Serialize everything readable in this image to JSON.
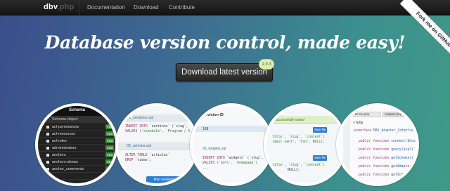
{
  "navbar": {
    "brand": "dbv",
    "brand_suffix": ".php",
    "links": [
      "Documentation",
      "Download",
      "Contribute"
    ]
  },
  "hero": {
    "title": "Database version control, made easy!",
    "download_button": "Download latest version",
    "version_badge": "1.0.3"
  },
  "ribbon": {
    "label": "Fork me on GitHub"
  },
  "screenshots": {
    "schema": {
      "header": "Schema",
      "sub": "Schema object",
      "rows": [
        {
          "name": "acl-permissions",
          "status": "YES"
        },
        {
          "name": "acl-resources",
          "status": "YES"
        },
        {
          "name": "acl-roles",
          "status": "YES"
        },
        {
          "name": "administrators",
          "status": "YES"
        },
        {
          "name": "anchors",
          "status": "YES"
        },
        {
          "name": "anchors-shows",
          "status": "YES"
        },
        {
          "name": "anchor_comments",
          "status": "YES"
        },
        {
          "name": "",
          "status": "YES"
        }
      ]
    },
    "migrations": {
      "file1": "01_sections.sql",
      "file1_line1_kw": "INSERT INTO",
      "file1_line1": " `sections` (`slug`, `",
      "file1_line2_kw": "VALUES",
      "file1_line2": " ('schedule', 'Program / S",
      "file2": "02_articles.sql",
      "file2_line1_kw": "ALTER TABLE",
      "file2_line1": " `articles`",
      "file2_line2_kw": "DROP",
      "file2_line2": " `views`;",
      "run_button": "Run revisions"
    },
    "revision": {
      "title": "Revision ID",
      "revision": "168",
      "file": "03_widgets.sql",
      "line1_kw": "INSERT INTO",
      "line1": " `widgets` (`slug`,",
      "line2_kw": "VALUES",
      "line2": " ('poll', 'homepage') ",
      "line3": "..."
    },
    "saved": {
      "alert": "successfully saved",
      "save_label": "Save file",
      "line1": "title`, `slug`, `content`)",
      "line2": "(mail-sent', 'Ton', NULL);",
      "line3": "title`, `slug`, `content`)",
      "line4": "NULL);"
    },
    "php": {
      "tab1": "Driver.php",
      "tab2": "Adapter.php",
      "line0": "<?php",
      "line1_kw": "interface",
      "line1": " DBV_Adapter_Interface",
      "methods": [
        {
          "kw": "public function",
          "fn": " connect($host"
        },
        {
          "kw": "public function",
          "fn": " query($sql)"
        },
        {
          "kw": "public function",
          "fn": " getSchema()"
        },
        {
          "kw": "public function",
          "fn": " getAdapter()"
        },
        {
          "kw": "public function",
          "fn": " getSchema()"
        }
      ]
    }
  }
}
